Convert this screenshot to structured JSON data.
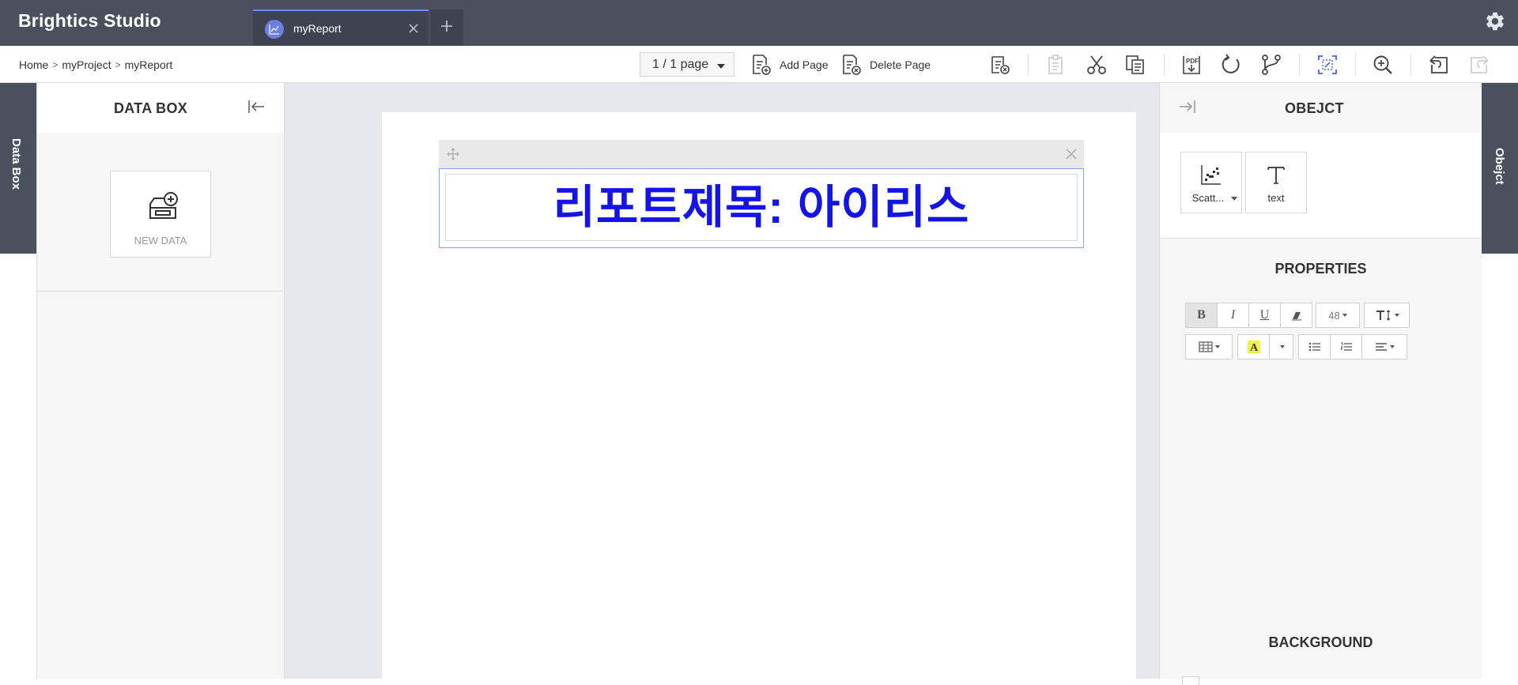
{
  "app": {
    "brand": "Brightics Studio"
  },
  "tabs": [
    {
      "label": "myReport"
    }
  ],
  "breadcrumb": {
    "home": "Home",
    "project": "myProject",
    "report": "myReport"
  },
  "toolbar": {
    "page_selector": "1 / 1 page",
    "add_page": "Add Page",
    "delete_page": "Delete Page"
  },
  "left_vertical_tab": "Data Box",
  "right_vertical_tab": "Obejct",
  "databox": {
    "title": "DATA BOX",
    "new_data": "NEW DATA"
  },
  "report": {
    "heading": "리포트제목: 아이리스"
  },
  "object_panel": {
    "title": "OBEJCT",
    "objects": [
      {
        "label": "Scatt..."
      },
      {
        "label": "text"
      }
    ],
    "properties_title": "PROPERTIES",
    "font_size": "48",
    "background_title": "BACKGROUND"
  },
  "colors": {
    "topbar": "#4b505f",
    "accent": "#6f8cf0",
    "heading_text": "#1414e6"
  }
}
